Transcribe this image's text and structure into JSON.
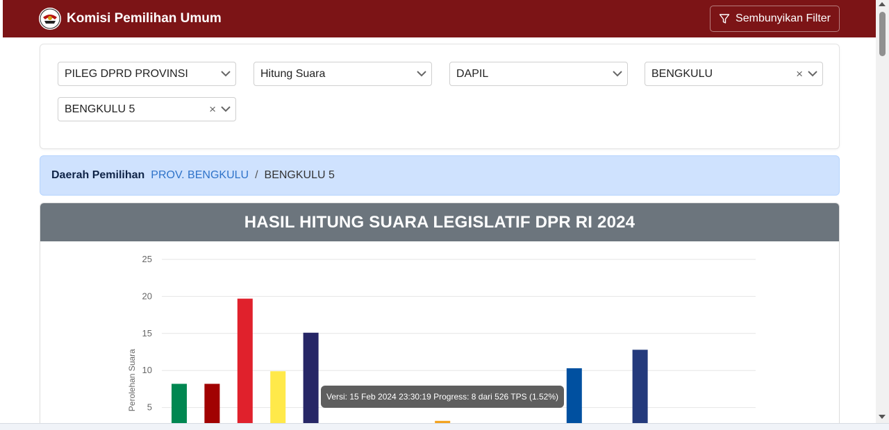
{
  "brand": {
    "title": "Komisi Pemilihan Umum"
  },
  "toolbar": {
    "filter_label": "Sembunyikan Filter"
  },
  "filters": {
    "election": "PILEG DPRD PROVINSI",
    "mode": "Hitung Suara",
    "level": "DAPIL",
    "region": "BENGKULU",
    "district": "BENGKULU 5"
  },
  "breadcrumb": {
    "label": "Daerah Pemilihan",
    "link": "PROV. BENGKULU",
    "separator": "/",
    "current": "BENGKULU 5"
  },
  "chart_title": "HASIL HITUNG SUARA LEGISLATIF DPR RI 2024",
  "tooltip": "Versi: 15 Feb 2024 23:30:19 Progress: 8 dari 526 TPS (1.52%)",
  "chart_data": {
    "type": "bar",
    "ylabel": "Perolehan Suara",
    "ylim": [
      0,
      25
    ],
    "yticks": [
      5,
      10,
      15,
      20,
      25
    ],
    "values": [
      8.2,
      8.2,
      19.7,
      9.9,
      15.1,
      0,
      0.8,
      0,
      3.2,
      0,
      0.6,
      0,
      10.3,
      0,
      12.8
    ],
    "colors": [
      "#008751",
      "#a10202",
      "#e0212c",
      "#ffe94a",
      "#262666",
      "#c4c4c4",
      "#f2610d",
      "#c4c4c4",
      "#f3a31f",
      "#c4c4c4",
      "#2a5ca4",
      "#c4c4c4",
      "#0050a0",
      "#c4c4c4",
      "#243a7c"
    ]
  }
}
